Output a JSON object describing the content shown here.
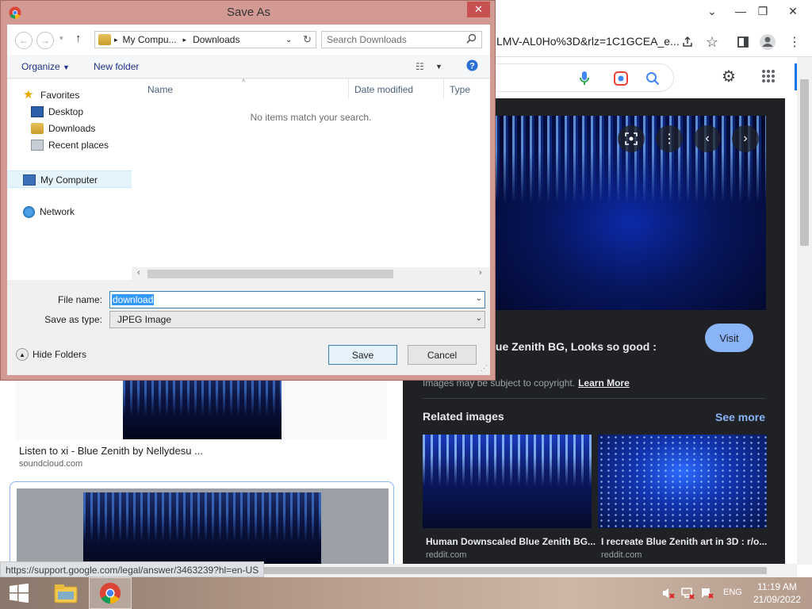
{
  "browser": {
    "omnibox_url": "LMV-AL0Ho%3D&rlz=1C1GCEA_e...",
    "status_url": "https://support.google.com/legal/answer/3463239?hl=en-US"
  },
  "results": {
    "result1_title": "Listen to xi - Blue Zenith by Nellydesu ...",
    "result1_source": "soundcloud.com"
  },
  "preview": {
    "title": "lue Zenith BG, Looks so good :",
    "visit_label": "Visit",
    "copyright_text": "Images may be subject to copyright.",
    "learn_more": "Learn More",
    "related_title": "Related images",
    "see_more": "See more",
    "related": [
      {
        "caption": "Human Downscaled Blue Zenith BG...",
        "source": "reddit.com"
      },
      {
        "caption": "I recreate Blue Zenith art in 3D : r/o...",
        "source": "reddit.com"
      }
    ]
  },
  "dialog": {
    "title": "Save As",
    "path": [
      "My Compu...",
      "Downloads"
    ],
    "search_placeholder": "Search Downloads",
    "organize_label": "Organize",
    "new_folder_label": "New folder",
    "nav": {
      "favorites": "Favorites",
      "desktop": "Desktop",
      "downloads": "Downloads",
      "recent_places": "Recent places",
      "my_computer": "My Computer",
      "network": "Network"
    },
    "columns": {
      "name": "Name",
      "date_modified": "Date modified",
      "type": "Type"
    },
    "empty_message": "No items match your search.",
    "file_name_label": "File name:",
    "file_name_value": "download",
    "save_type_label": "Save as type:",
    "save_type_value": "JPEG Image",
    "hide_folders_label": "Hide Folders",
    "save_label": "Save",
    "cancel_label": "Cancel"
  },
  "taskbar": {
    "language": "ENG",
    "time": "11:19 AM",
    "date": "21/09/2022"
  },
  "colors": {
    "dialog_frame": "#d39a93",
    "chrome_dark_panel": "#202124",
    "link_blue": "#8ab4f8",
    "selection_blue": "#3399ff"
  }
}
